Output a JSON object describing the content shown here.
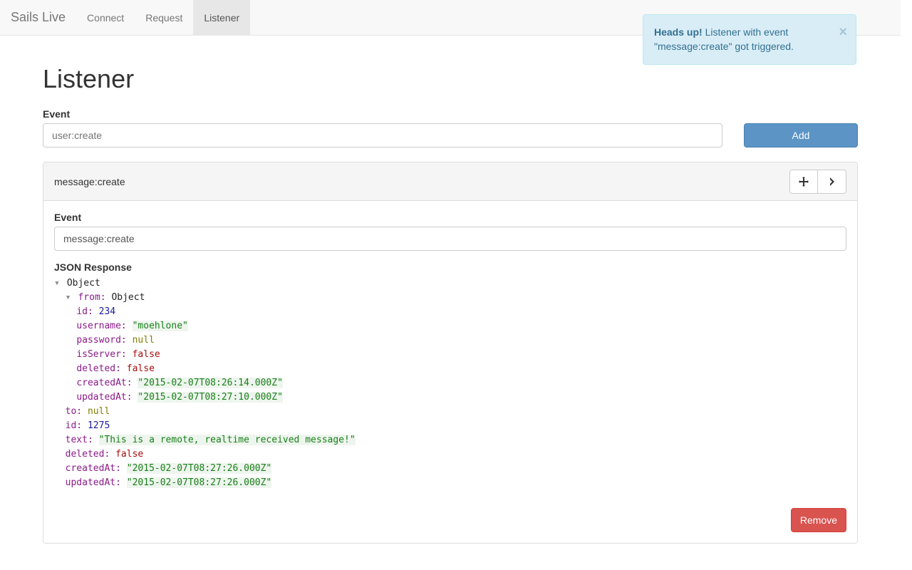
{
  "nav": {
    "brand": "Sails Live",
    "items": [
      {
        "label": "Connect",
        "active": false
      },
      {
        "label": "Request",
        "active": false
      },
      {
        "label": "Listener",
        "active": true
      }
    ]
  },
  "alert": {
    "lead": "Heads up!",
    "body": "Listener with event \"message:create\" got triggered."
  },
  "page": {
    "title": "Listener",
    "event_label": "Event",
    "event_placeholder": "user:create",
    "add_button": "Add"
  },
  "listener": {
    "name": "message:create",
    "event_label": "Event",
    "event_value": "message:create",
    "json_section_label": "JSON Response",
    "remove_button": "Remove"
  },
  "json_tokens": {
    "object": "Object",
    "from": "from:",
    "id": "id:",
    "id_val_inner": "234",
    "username": "username:",
    "username_val": "\"moehlone\"",
    "password": "password:",
    "null": "null",
    "isServer": "isServer:",
    "false": "false",
    "deleted": "deleted:",
    "createdAt": "createdAt:",
    "createdAt_inner": "\"2015-02-07T08:26:14.000Z\"",
    "updatedAt": "updatedAt:",
    "updatedAt_inner": "\"2015-02-07T08:27:10.000Z\"",
    "to": "to:",
    "id_val_outer": "1275",
    "text": "text:",
    "text_val": "\"This is a remote, realtime received message!\"",
    "createdAt_outer": "\"2015-02-07T08:27:26.000Z\"",
    "updatedAt_outer": "\"2015-02-07T08:27:26.000Z\""
  }
}
